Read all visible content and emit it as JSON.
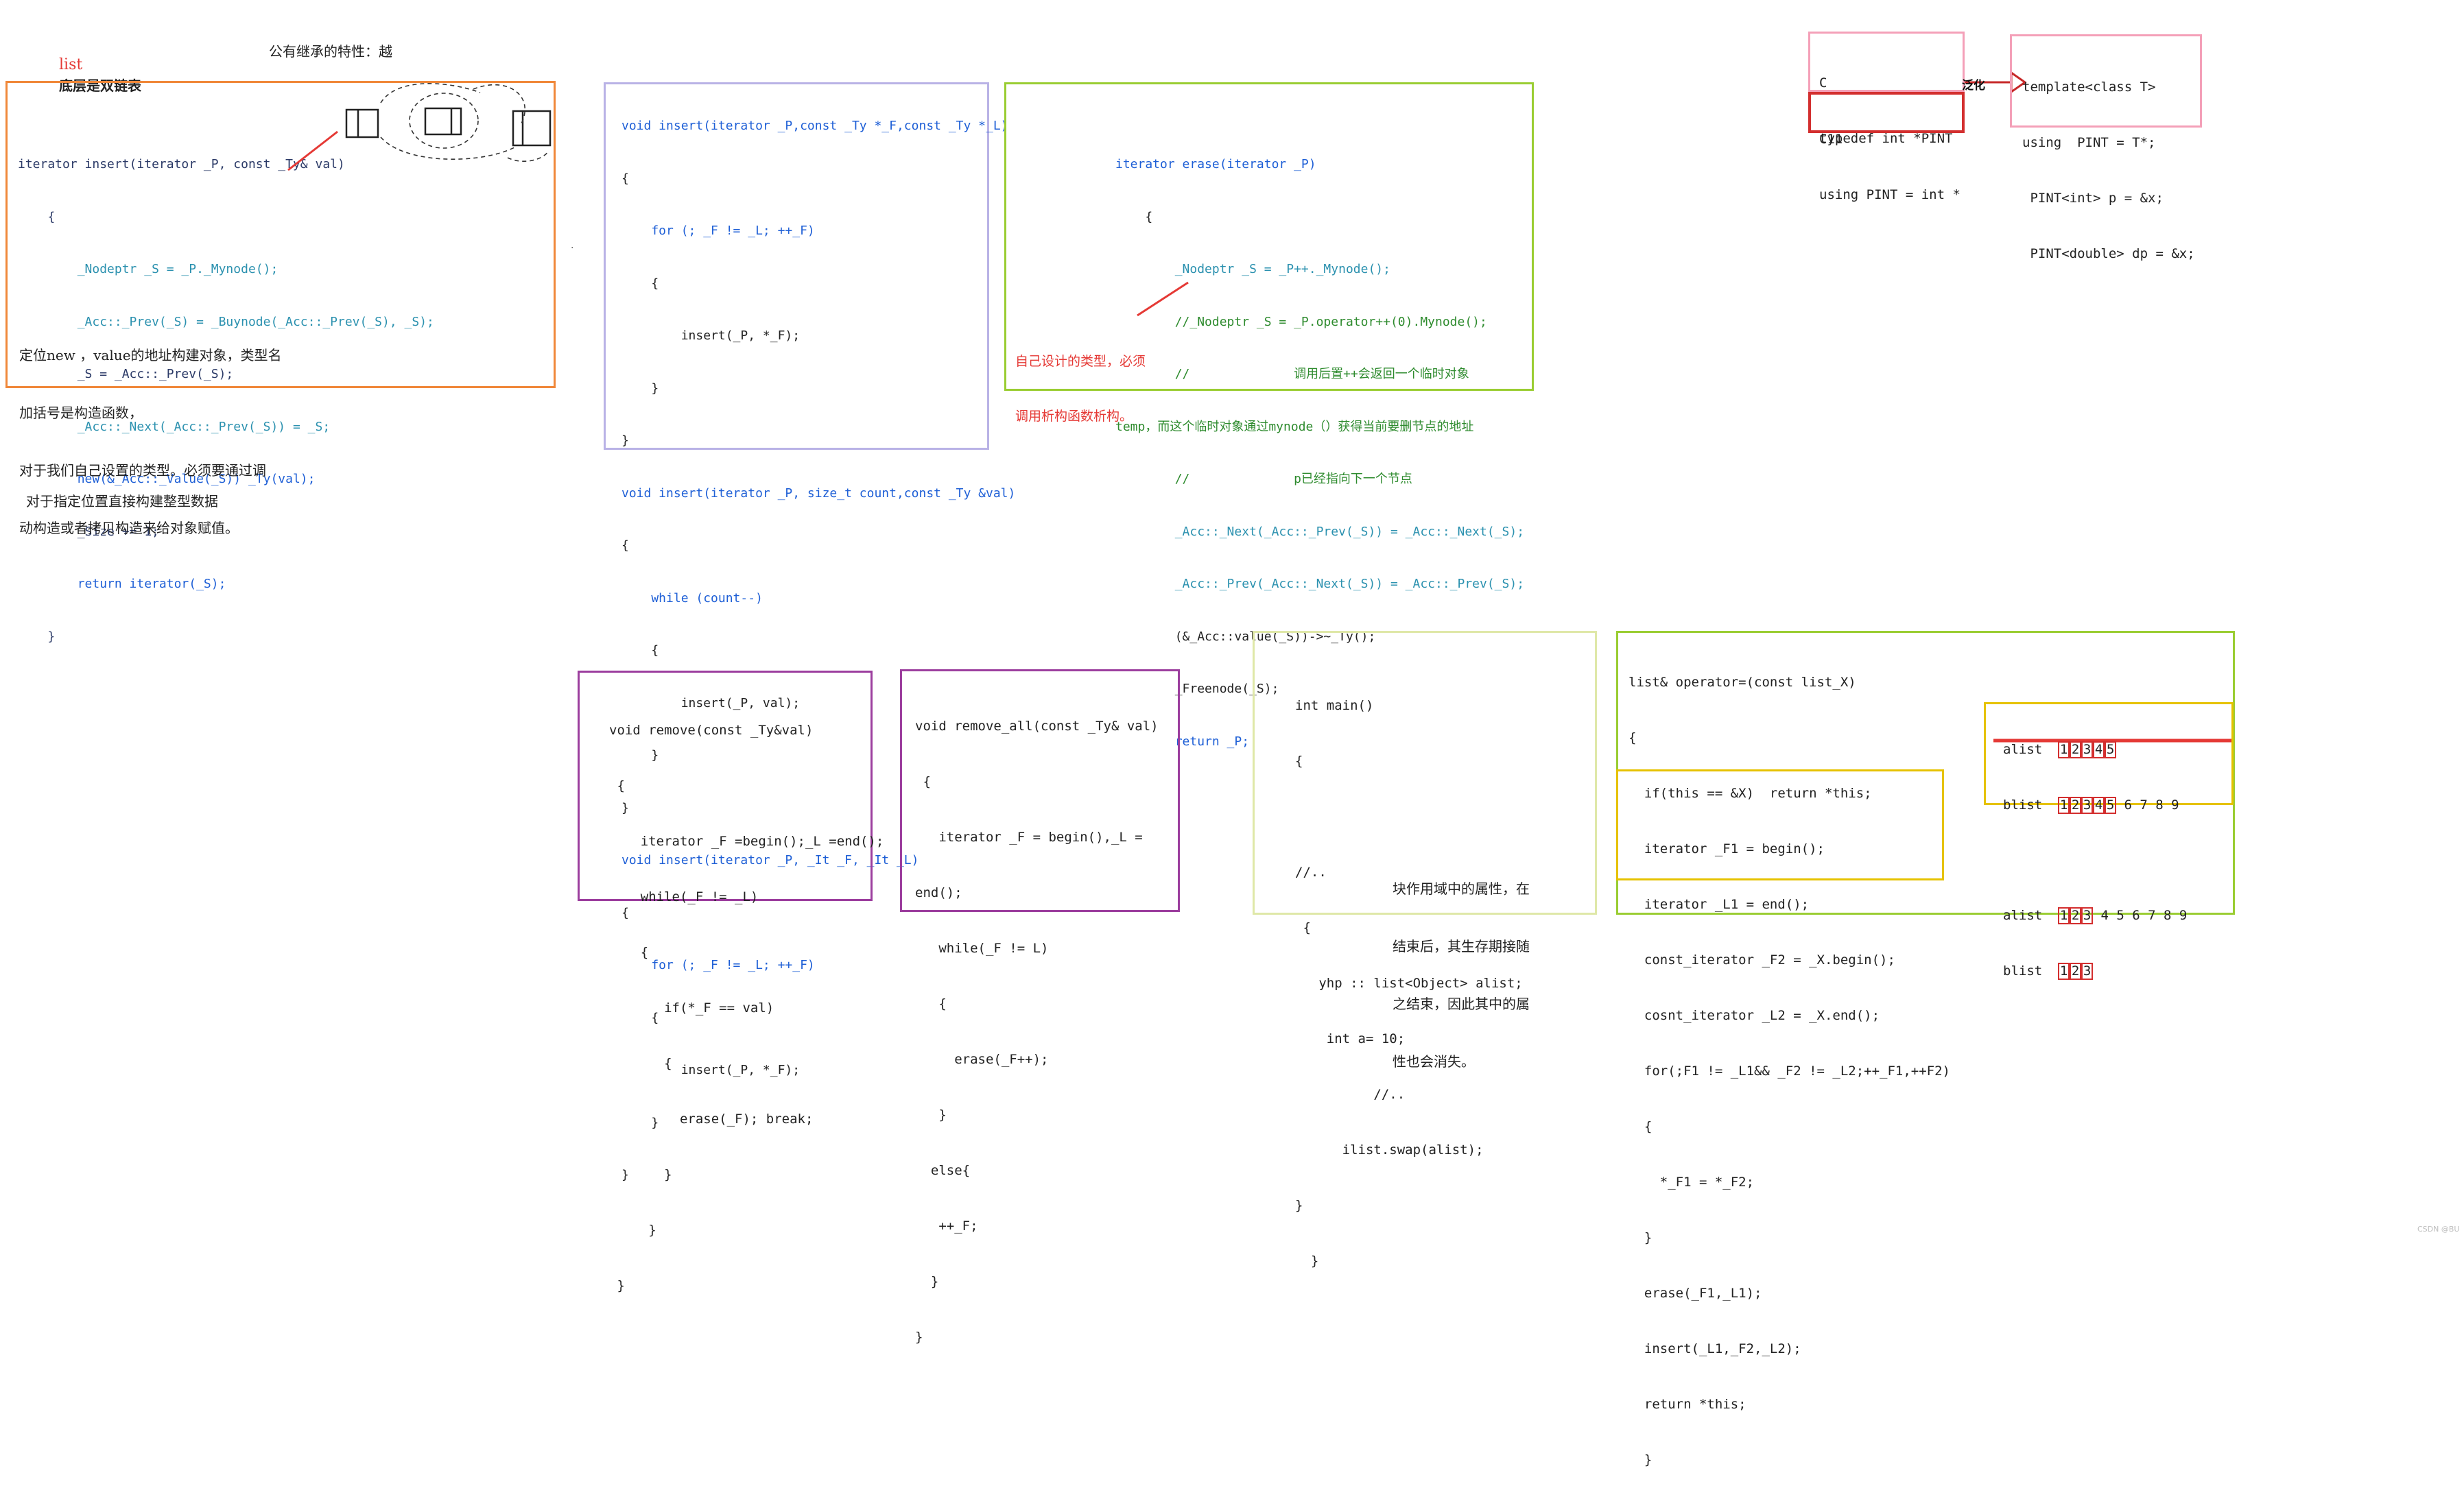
{
  "headings": {
    "title_red": "list",
    "title_black": "底层是双链表",
    "inherit": "公有继承的特性：越",
    "construct_note": "对于指定位置直接构建整型数据"
  },
  "insert_box": {
    "code": [
      "iterator insert(iterator _P, const _Ty& val)",
      "    {",
      "        _Nodeptr _S = _P._Mynode();",
      "        _Acc::_Prev(_S) = _Buynode(_Acc::_Prev(_S), _S);",
      "        _S = _Acc::_Prev(_S);",
      "        _Acc::_Next(_Acc::_Prev(_S)) = _S;",
      "        new(&_Acc::_Value(_S)) _Ty(val);",
      "        _Size += 1;",
      "        return iterator(_S);",
      "    }"
    ],
    "note": [
      "定位new ，value的地址构建对象，类型名",
      "加括号是构造函数，",
      "对于我们自己设置的类型。必须要通过调",
      "动构造或者拷贝构造来给对象赋值。"
    ]
  },
  "insert_overloads": [
    "void insert(iterator _P,const _Ty *_F,const _Ty *_L)",
    "{",
    "    for (; _F != _L; ++_F)",
    "    {",
    "        insert(_P, *_F);",
    "    }",
    "}",
    "void insert(iterator _P, size_t count,const _Ty &val)",
    "{",
    "    while (count--)",
    "    {",
    "        insert(_P, val);",
    "    }",
    "}",
    "void insert(iterator _P, _It _F, _It _L)",
    "{",
    "    for (; _F != _L; ++_F)",
    "    {",
    "        insert(_P, *_F);",
    "    }",
    "}"
  ],
  "erase_box": {
    "code": [
      "iterator erase(iterator _P)",
      "    {",
      "        _Nodeptr _S = _P++._Mynode();",
      "        //_Nodeptr _S = _P.operator++(0).Mynode();",
      "        //              调用后置++会返回一个临时对象",
      "temp，而这个临时对象通过mynode（）获得当前要删节点的地址",
      "        //              p已经指向下一个节点",
      "        _Acc::_Next(_Acc::_Prev(_S)) = _Acc::_Next(_S);",
      "        _Acc::_Prev(_Acc::_Next(_S)) = _Acc::_Prev(_S);",
      "        (&_Acc::value(_S))->~_Ty();",
      "        _Freenode(_S);",
      "        return _P;"
    ],
    "annotation": [
      "自己设计的类型，必须",
      "调用析构函数析构。"
    ]
  },
  "typedef_box": {
    "c_label": "C",
    "c_code": "typedef int *PINT",
    "c11_label": "C11",
    "c11_code": "using PINT = int *",
    "arrow_label": "泛化",
    "template_code": [
      "template<class T>",
      "using  PINT = T*;",
      " PINT<int> p = &x;",
      " PINT<double> dp = &x;"
    ]
  },
  "remove_box": [
    "void remove(const _Ty&val)",
    " {",
    "    iterator _F =begin();_L =end();",
    "    while(_F != _L)",
    "    {",
    "       if(*_F == val)",
    "       {",
    "         erase(_F); break;",
    "       }",
    "     }",
    " }"
  ],
  "remove_all_box": [
    "void remove_all(const _Ty& val)",
    " {",
    "   iterator _F = begin(),_L =",
    "end();",
    "   while(_F != L)",
    "   {",
    "     erase(_F++);",
    "   }",
    "  else{",
    "   ++_F;",
    "  }",
    "}"
  ],
  "main_box": {
    "code": [
      "int main()",
      "{",
      "",
      "//..",
      " {",
      "   yhp :: list<Object> alist;",
      "    int a= 10;",
      "          //..",
      "      ilist.swap(alist);",
      "}",
      "  }"
    ],
    "note": [
      "块作用域中的属性，在",
      "结束后，其生存期接随",
      "之结束，因此其中的属",
      "性也会消失。"
    ]
  },
  "operator_box": [
    "list& operator=(const list_X)",
    "{",
    "  if(this == &X)  return *this;",
    "  iterator _F1 = begin();",
    "  iterator _L1 = end();",
    "  const_iterator _F2 = _X.begin();",
    "  cosnt_iterator _L2 = _X.end();",
    "  for(;F1 != _L1&& _F2 != _L2;++_F1,++F2)",
    "  {",
    "    *_F1 = *_F2;",
    "  }",
    "  erase(_F1,_L1);",
    "  insert(_L1,_F2,_L2);",
    "  return *this;",
    "  }"
  ],
  "list_demo": {
    "before": [
      {
        "label": "alist",
        "boxed": [
          "1",
          "2",
          "3",
          "4",
          "5"
        ],
        "plain": ""
      },
      {
        "label": "blist",
        "boxed": [
          "1",
          "2",
          "3",
          "4",
          "5"
        ],
        "plain": "6 7 8 9"
      }
    ],
    "after": [
      {
        "label": "alist",
        "boxed": [
          "1",
          "2",
          "3"
        ],
        "plain": "4 5 6 7 8 9"
      },
      {
        "label": "blist",
        "boxed": [
          "1",
          "2",
          "3"
        ],
        "plain": ""
      }
    ]
  },
  "watermark": "CSDN @BU",
  "colors": {
    "orange": "#f0883a",
    "lavender": "#b9b2e6",
    "green": "#9acd32",
    "pink": "#f4a0b8",
    "red": "#e53935",
    "purple": "#9c3e9e",
    "pale_green": "#dfe8a8",
    "yellow": "#e6c200"
  }
}
